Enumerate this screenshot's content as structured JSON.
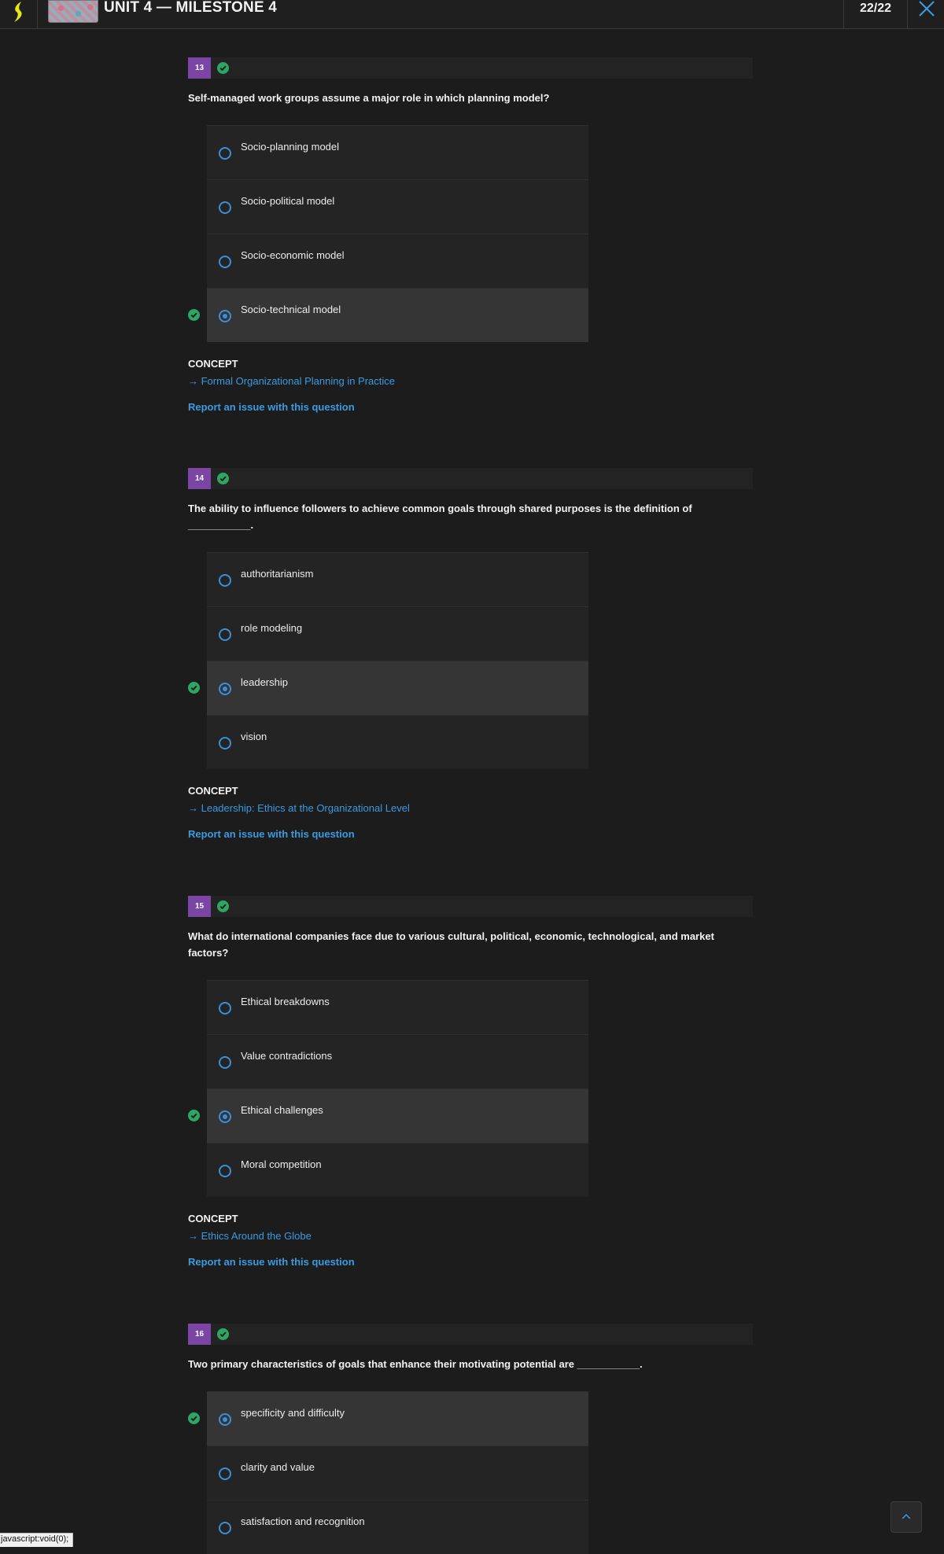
{
  "header": {
    "title": "UNIT 4 — MILESTONE 4",
    "score": "22/22",
    "logo_icon": "lightning-icon",
    "close_icon": "close-icon"
  },
  "colors": {
    "accent_blue": "#3a9be0",
    "badge_purple": "#7b45a6",
    "correct_green": "#2fa564",
    "logo_yellow": "#e4e816"
  },
  "questions": [
    {
      "number": "13",
      "text": "Self-managed work groups assume a major role in which planning model?",
      "options": [
        {
          "label": "Socio-planning model",
          "selected": false
        },
        {
          "label": "Socio-political model",
          "selected": false
        },
        {
          "label": "Socio-economic model",
          "selected": false
        },
        {
          "label": "Socio-technical model",
          "selected": true
        }
      ],
      "concept_label": "CONCEPT",
      "concept_link": "→ Formal Organizational Planning in Practice",
      "report_link": "Report an issue with this question"
    },
    {
      "number": "14",
      "text": "The ability to influence followers to achieve common goals through shared purposes is the definition of ___________.",
      "options": [
        {
          "label": "authoritarianism",
          "selected": false
        },
        {
          "label": "role modeling",
          "selected": false
        },
        {
          "label": "leadership",
          "selected": true
        },
        {
          "label": "vision",
          "selected": false
        }
      ],
      "concept_label": "CONCEPT",
      "concept_link": "→ Leadership: Ethics at the Organizational Level",
      "report_link": "Report an issue with this question"
    },
    {
      "number": "15",
      "text": "What do international companies face due to various cultural, political, economic, technological, and market factors?",
      "options": [
        {
          "label": "Ethical breakdowns",
          "selected": false
        },
        {
          "label": "Value contradictions",
          "selected": false
        },
        {
          "label": "Ethical challenges",
          "selected": true
        },
        {
          "label": "Moral competition",
          "selected": false
        }
      ],
      "concept_label": "CONCEPT",
      "concept_link": "→ Ethics Around the Globe",
      "report_link": "Report an issue with this question"
    },
    {
      "number": "16",
      "text": "Two primary characteristics of goals that enhance their motivating potential are ___________.",
      "options": [
        {
          "label": "specificity and difficulty",
          "selected": true
        },
        {
          "label": "clarity and value",
          "selected": false
        },
        {
          "label": "satisfaction and recognition",
          "selected": false
        }
      ]
    }
  ],
  "status_bar": {
    "url": "javascript:void(0);"
  },
  "scroll_top_icon": "chevron-up-icon"
}
